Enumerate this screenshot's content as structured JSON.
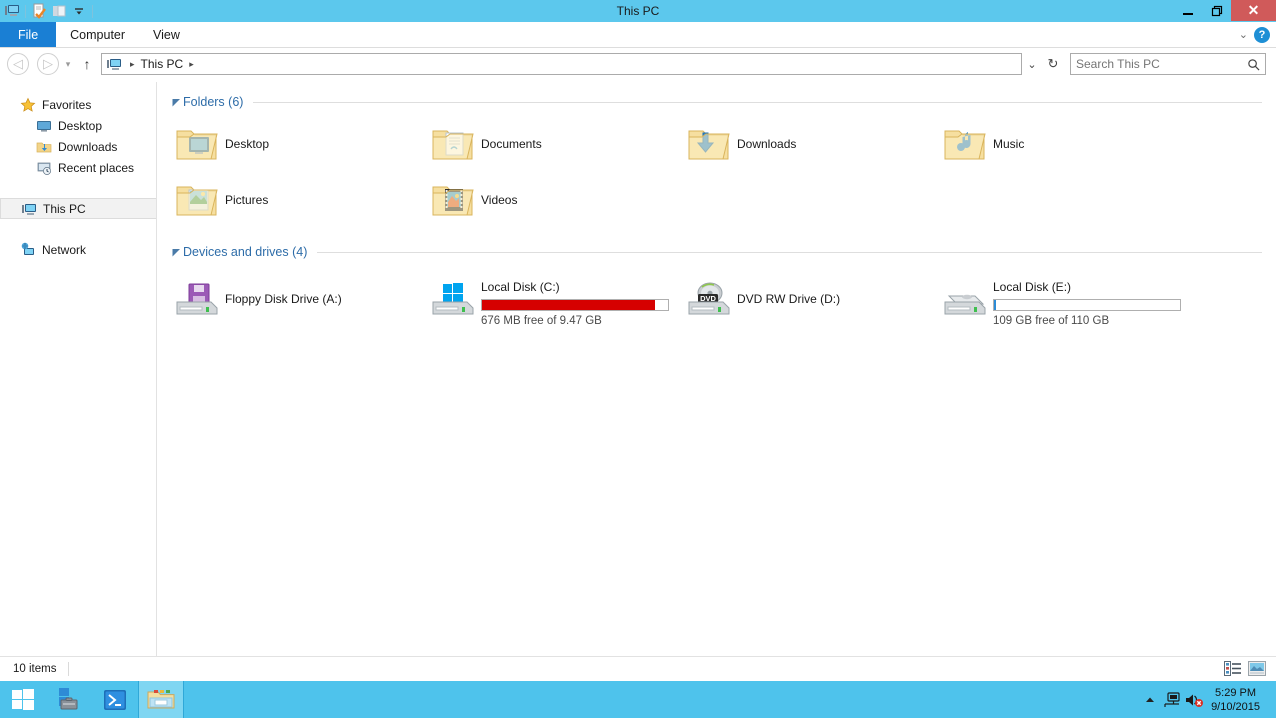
{
  "window": {
    "title": "This PC",
    "minimize_label": "minimize",
    "restore_label": "restore",
    "close_label": "✕"
  },
  "quick_access": {
    "items": [
      {
        "name": "this-pc-icon",
        "label": "This PC"
      },
      {
        "name": "properties-icon",
        "label": "Properties"
      },
      {
        "name": "new-folder-icon",
        "label": "New folder"
      },
      {
        "name": "customize-dropdown-icon",
        "label": "Customize Quick Access Toolbar"
      }
    ]
  },
  "ribbon": {
    "tabs": [
      {
        "label": "File",
        "active": true
      },
      {
        "label": "Computer",
        "active": false
      },
      {
        "label": "View",
        "active": false
      }
    ],
    "expand_label": "⌄",
    "help_label": "?"
  },
  "address_bar": {
    "back_label": "◁",
    "forward_label": "▷",
    "recent_label": "▾",
    "up_label": "↑",
    "crumbs": [
      {
        "text": "This PC",
        "icon": "this-pc-icon"
      }
    ],
    "crumb_separator": "▸",
    "dropdown_label": "⌄",
    "refresh_label": "↻"
  },
  "search": {
    "placeholder": "Search This PC",
    "value": "",
    "icon": "search-icon"
  },
  "sidebar": {
    "items": [
      {
        "label": "Favorites",
        "icon": "star-icon",
        "level": 0,
        "selected": false
      },
      {
        "label": "Desktop",
        "icon": "desktop-icon",
        "level": 1,
        "selected": false
      },
      {
        "label": "Downloads",
        "icon": "downloads-folder-icon",
        "level": 1,
        "selected": false
      },
      {
        "label": "Recent places",
        "icon": "recent-places-icon",
        "level": 1,
        "selected": false
      },
      {
        "label": "This PC",
        "icon": "this-pc-icon",
        "level": 0,
        "selected": true
      },
      {
        "label": "Network",
        "icon": "network-icon",
        "level": 0,
        "selected": false
      }
    ]
  },
  "main": {
    "groups": [
      {
        "title": "Folders (6)",
        "collapse_glyph": "◢",
        "items": [
          {
            "label": "Desktop",
            "icon": "desktop-folder-icon"
          },
          {
            "label": "Documents",
            "icon": "documents-folder-icon"
          },
          {
            "label": "Downloads",
            "icon": "downloads-folder-icon"
          },
          {
            "label": "Music",
            "icon": "music-folder-icon"
          },
          {
            "label": "Pictures",
            "icon": "pictures-folder-icon"
          },
          {
            "label": "Videos",
            "icon": "videos-folder-icon"
          }
        ]
      },
      {
        "title": "Devices and drives (4)",
        "collapse_glyph": "◢",
        "items": [
          {
            "label": "Floppy Disk Drive (A:)",
            "icon": "floppy-drive-icon",
            "has_bar": false,
            "free_text": ""
          },
          {
            "label": "Local Disk (C:)",
            "icon": "windows-drive-icon",
            "has_bar": true,
            "fill_percent": 93,
            "fill_color": "#D60000",
            "free_text": "676 MB free of 9.47 GB"
          },
          {
            "label": "DVD RW Drive (D:)",
            "icon": "dvd-drive-icon",
            "has_bar": false,
            "free_text": ""
          },
          {
            "label": "Local Disk (E:)",
            "icon": "local-drive-icon",
            "has_bar": true,
            "fill_percent": 1,
            "fill_color": "#2C8BD6",
            "free_text": "109 GB free of 110 GB"
          }
        ]
      }
    ]
  },
  "status_bar": {
    "item_count": "10 items",
    "view_details_label": "Details view",
    "view_large_icons_label": "Large icons view"
  },
  "taskbar": {
    "start_label": "Start",
    "items": [
      {
        "name": "server-manager",
        "label": "Server Manager",
        "active": false
      },
      {
        "name": "powershell",
        "label": "Windows PowerShell",
        "active": false
      },
      {
        "name": "file-explorer",
        "label": "File Explorer",
        "active": true
      }
    ],
    "tray": {
      "show_hidden_label": "▲",
      "network_label": "Network",
      "volume_label": "Volume muted"
    },
    "clock": {
      "time": "5:29 PM",
      "date": "9/10/2015"
    }
  },
  "colors": {
    "titlebar": "#5CC8ED",
    "accent_blue": "#1A7FD4",
    "group_header": "#2D6CA8",
    "taskbar": "#4EC3EC",
    "drive_full_red": "#D60000"
  }
}
